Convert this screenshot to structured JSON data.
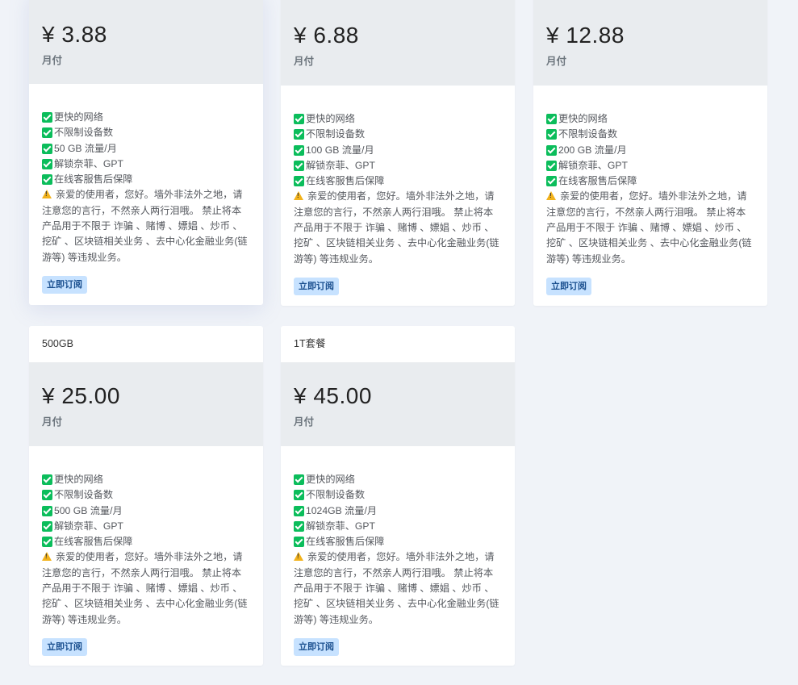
{
  "plans": [
    {
      "title": "",
      "price": "¥ 3.88",
      "period": "月付",
      "features": [
        "更快的网络",
        "不限制设备数",
        "50 GB 流量/月",
        "解锁奈菲、GPT",
        "在线客服售后保障"
      ],
      "warning": "亲爱的使用者，您好。墙外非法外之地，请注意您的言行，不然亲人两行泪哦。 禁止将本产品用于不限于 诈骗 、赌博 、嫖娼 、炒币 、挖矿 、区块链相关业务 、去中心化金融业务(链游等) 等违规业务。",
      "button": "立即订阅"
    },
    {
      "title": "",
      "price": "¥ 6.88",
      "period": "月付",
      "features": [
        "更快的网络",
        "不限制设备数",
        "100 GB 流量/月",
        "解锁奈菲、GPT",
        "在线客服售后保障"
      ],
      "warning": "亲爱的使用者，您好。墙外非法外之地，请注意您的言行，不然亲人两行泪哦。 禁止将本产品用于不限于 诈骗 、赌博 、嫖娼 、炒币 、挖矿 、区块链相关业务 、去中心化金融业务(链游等) 等违规业务。",
      "button": "立即订阅"
    },
    {
      "title": "",
      "price": "¥ 12.88",
      "period": "月付",
      "features": [
        "更快的网络",
        "不限制设备数",
        "200 GB 流量/月",
        "解锁奈菲、GPT",
        "在线客服售后保障"
      ],
      "warning": "亲爱的使用者，您好。墙外非法外之地，请注意您的言行，不然亲人两行泪哦。 禁止将本产品用于不限于 诈骗 、赌博 、嫖娼 、炒币 、挖矿 、区块链相关业务 、去中心化金融业务(链游等) 等违规业务。",
      "button": "立即订阅"
    },
    {
      "title": "500GB",
      "price": "¥ 25.00",
      "period": "月付",
      "features": [
        "更快的网络",
        "不限制设备数",
        "500 GB 流量/月",
        "解锁奈菲、GPT",
        "在线客服售后保障"
      ],
      "warning": "亲爱的使用者，您好。墙外非法外之地，请注意您的言行，不然亲人两行泪哦。 禁止将本产品用于不限于 诈骗 、赌博 、嫖娼 、炒币 、挖矿 、区块链相关业务 、去中心化金融业务(链游等) 等违规业务。",
      "button": "立即订阅"
    },
    {
      "title": "1T套餐",
      "price": "¥ 45.00",
      "period": "月付",
      "features": [
        "更快的网络",
        "不限制设备数",
        "1024GB 流量/月",
        "解锁奈菲、GPT",
        "在线客服售后保障"
      ],
      "warning": "亲爱的使用者，您好。墙外非法外之地，请注意您的言行，不然亲人两行泪哦。 禁止将本产品用于不限于 诈骗 、赌博 、嫖娼 、炒币 、挖矿 、区块链相关业务 、去中心化金融业务(链游等) 等违规业务。",
      "button": "立即订阅"
    }
  ],
  "colors": {
    "page_background": "#f0f3f8",
    "price_block_background": "#e9ecef",
    "check_green": "#0bbd5b",
    "warning_yellow": "#f2b21b",
    "button_background": "#c7e2ff",
    "button_text": "#1a4f8f"
  },
  "icons": {
    "feature": "check-square-icon",
    "warning": "warning-triangle-icon"
  }
}
